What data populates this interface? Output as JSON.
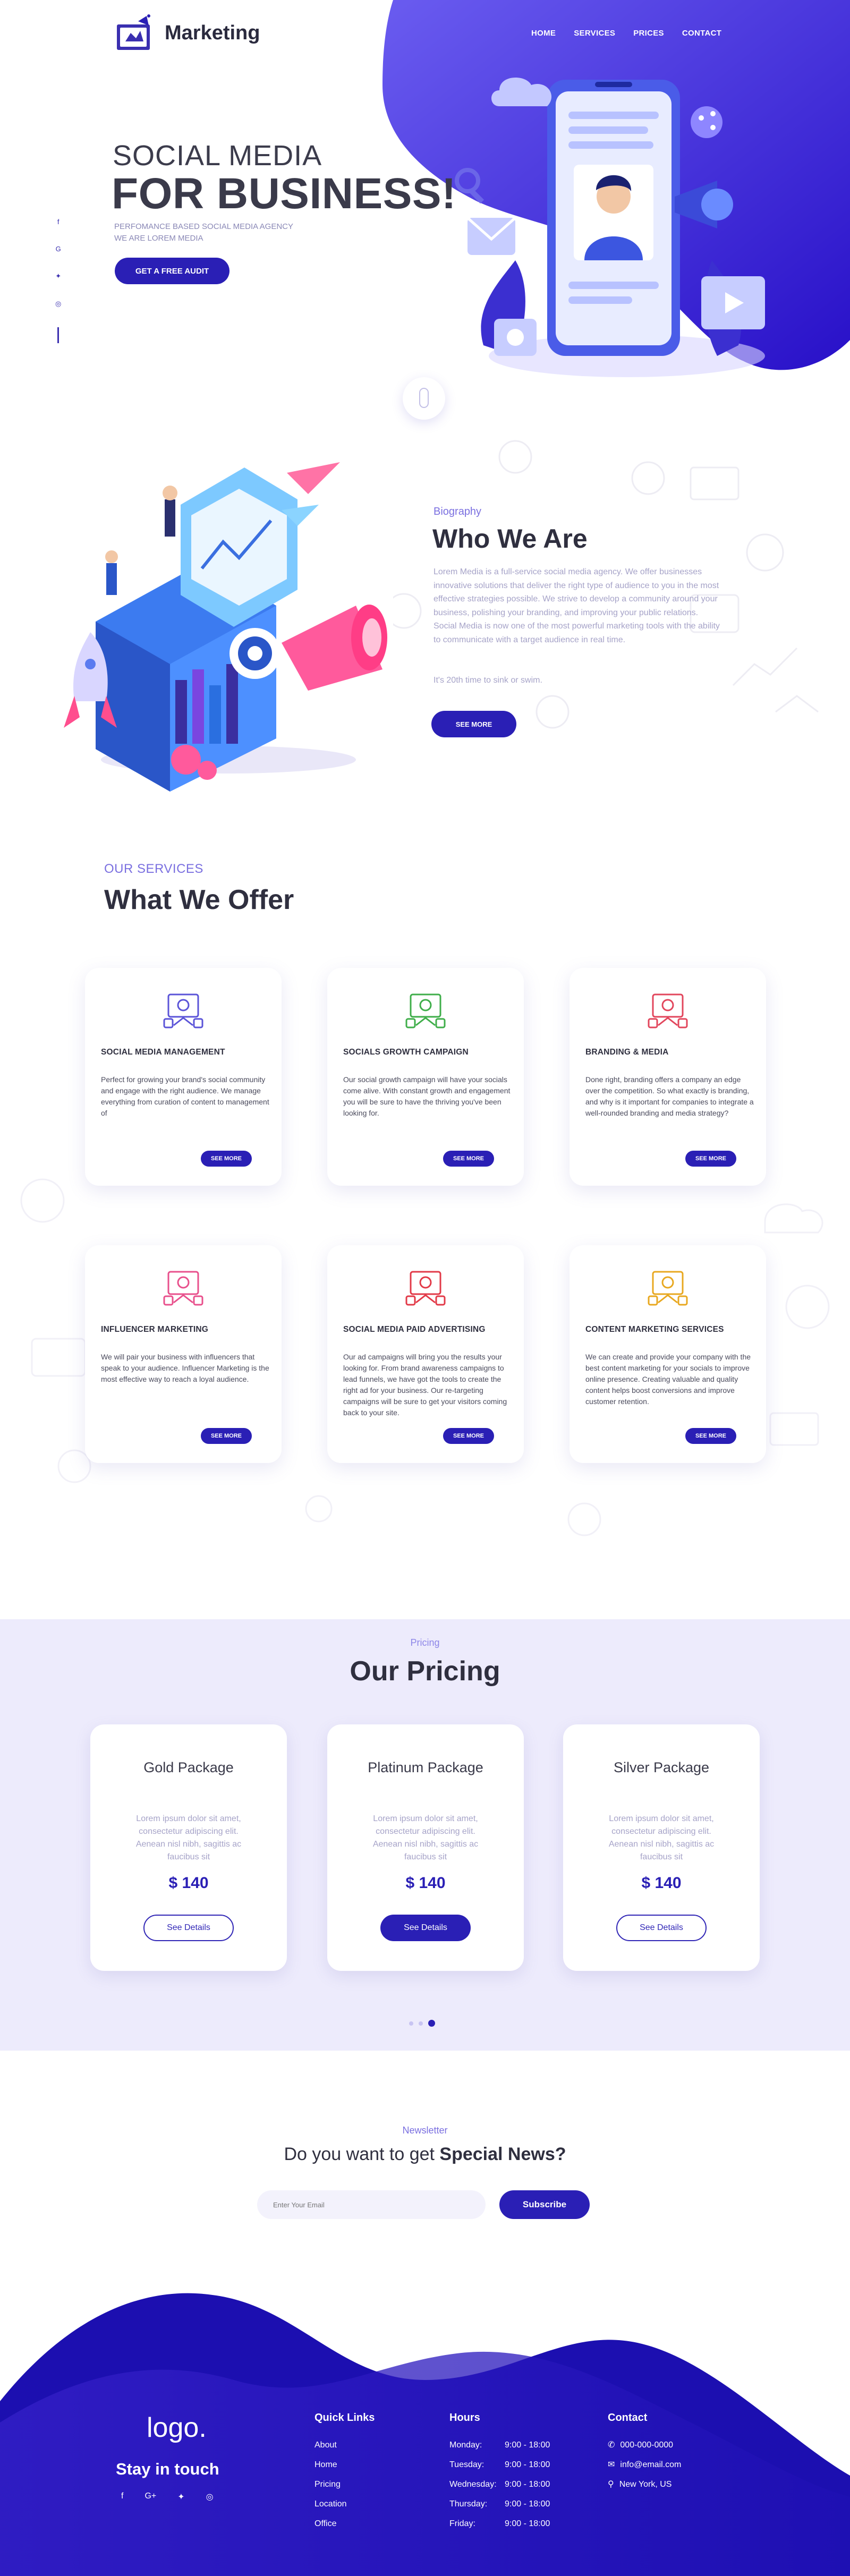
{
  "brand": {
    "name": "Marketing",
    "accent": "#2a1fb5",
    "hero_blue": "#3a1fd8"
  },
  "nav": {
    "home": "HOME",
    "services": "SERVICES",
    "prices": "PRICES",
    "contact": "CONTACT"
  },
  "hero": {
    "line1": "SOCIAL MEDIA",
    "line2": "FOR BUSINESS!",
    "sub1": "PERFOMANCE BASED SOCIAL MEDIA AGENCY",
    "sub2": "WE ARE LOREM MEDIA",
    "cta": "GET A FREE AUDIT"
  },
  "about": {
    "kicker": "Biography",
    "title": "Who We Are",
    "text": "Lorem Media is a full-service social media agency. We offer businesses innovative solutions that deliver the right type of audience to you in the most effective strategies possible. We strive to develop a community around your business, polishing your branding, and improving your public relations. Social Media is now one of the most powerful marketing tools with the ability to communicate with a target audience in real time.",
    "text2": "It's 20th time to sink or swim.",
    "cta": "SEE MORE"
  },
  "services": {
    "kicker": "OUR SERVICES",
    "title": "What We Offer",
    "more": "SEE MORE",
    "items": [
      {
        "title": "SOCIAL MEDIA MANAGEMENT",
        "text": "Perfect for growing your brand's social community and engage with the right audience. We manage everything from curation of content to management of",
        "icon": "social-management-icon",
        "color": "#5b54d8"
      },
      {
        "title": "SOCIALS GROWTH CAMPAIGN",
        "text": "Our social growth campaign will have your socials come alive. With constant growth and engagement you will be sure to have the thriving you've been looking for.",
        "icon": "growth-campaign-icon",
        "color": "#3fae4a"
      },
      {
        "title": "BRANDING & MEDIA",
        "text": "Done right, branding offers a company an edge over the competition. So what exactly is branding, and why is it important for companies to integrate a well-rounded branding and media strategy?",
        "icon": "branding-media-icon",
        "color": "#e2465c"
      },
      {
        "title": "INFLUENCER MARKETING",
        "text": "We will pair your business with influencers that speak to your audience. Influencer Marketing is the most effective way to reach a loyal audience.",
        "icon": "influencer-icon",
        "color": "#e8508c"
      },
      {
        "title": "SOCIAL MEDIA PAID ADVERTISING",
        "text": "Our ad campaigns will bring you the results your looking for. From brand awareness campaigns to lead funnels, we have got the tools to create the right ad for your business. Our re-targeting campaigns will be sure to get your visitors coming back to your site.",
        "icon": "paid-advertising-icon",
        "color": "#e23a48"
      },
      {
        "title": "CONTENT MARKETING SERVICES",
        "text": "We can create and provide your company with the best content marketing for your socials to improve online presence. Creating valuable and quality content helps boost conversions and improve customer retention.",
        "icon": "content-marketing-icon",
        "color": "#e8a820"
      }
    ]
  },
  "pricing": {
    "kicker": "Pricing",
    "title": "Our Pricing",
    "plans": [
      {
        "name": "Gold Package",
        "desc": "Lorem ipsum dolor sit amet, consectetur adipiscing elit. Aenean nisl nibh, sagittis ac faucibus sit",
        "price": "$ 140",
        "cta": "See Details"
      },
      {
        "name": "Platinum Package",
        "desc": "Lorem ipsum dolor sit amet, consectetur adipiscing elit. Aenean nisl nibh, sagittis ac faucibus sit",
        "price": "$ 140",
        "cta": "See Details"
      },
      {
        "name": "Silver Package",
        "desc": "Lorem ipsum dolor sit amet, consectetur adipiscing elit. Aenean nisl nibh, sagittis ac faucibus sit",
        "price": "$ 140",
        "cta": "See Details"
      }
    ],
    "active_dot": 3
  },
  "newsletter": {
    "kicker": "Newsletter",
    "title_a": "Do you want to get ",
    "title_b": "Special News?",
    "placeholder": "Enter Your Email",
    "cta": "Subscribe"
  },
  "footer": {
    "logo": "logo.",
    "stay": "Stay in touch",
    "links_title": "Quick Links",
    "links": [
      "About",
      "Home",
      "Pricing",
      "Location",
      "Office"
    ],
    "hours_title": "Hours",
    "hours": [
      {
        "day": "Monday:",
        "time": "9:00 - 18:00"
      },
      {
        "day": "Tuesday:",
        "time": "9:00 - 18:00"
      },
      {
        "day": "Wednesday:",
        "time": "9:00 - 18:00"
      },
      {
        "day": "Thursday:",
        "time": "9:00 - 18:00"
      },
      {
        "day": "Friday:",
        "time": "9:00 - 18:00"
      }
    ],
    "contact_title": "Contact",
    "phone": "000-000-0000",
    "email": "info@email.com",
    "location": "New York, US"
  }
}
